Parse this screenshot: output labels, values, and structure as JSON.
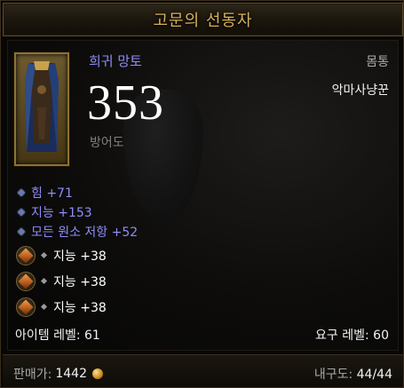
{
  "item": {
    "name": "고문의 선동자",
    "quality_type": "희귀 망토",
    "slot": "몸통",
    "class": "악마사냥꾼",
    "armor_value": "353",
    "armor_label": "방어도",
    "icon": "cloak-icon"
  },
  "stats": [
    "힘 +71",
    "지능 +153",
    "모든 원소 저항 +52"
  ],
  "sockets": [
    {
      "gem_icon": "topaz-gem-icon",
      "bonus": "지능 +38"
    },
    {
      "gem_icon": "topaz-gem-icon",
      "bonus": "지능 +38"
    },
    {
      "gem_icon": "topaz-gem-icon",
      "bonus": "지능 +38"
    }
  ],
  "item_level": "아이템 레벨: 61",
  "required_level": "요구 레벨: 60",
  "footer": {
    "sell_label": "판매가:",
    "sell_value": "1442",
    "durability_label": "내구도:",
    "durability_value": "44/44"
  },
  "colors": {
    "title": "#d7b25a",
    "magic_stat": "#8f8df7",
    "white_text": "#f2f2f2",
    "gray_text": "#a9a9a9"
  }
}
